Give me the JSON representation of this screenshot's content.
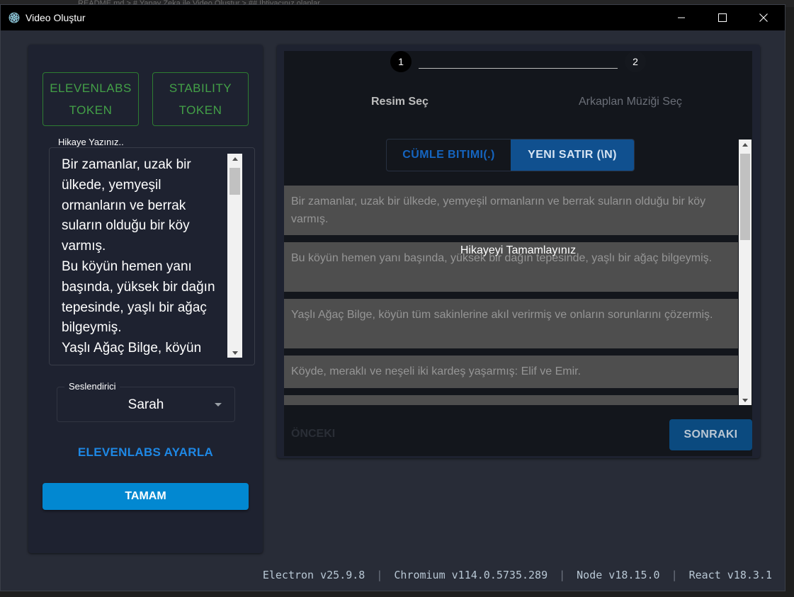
{
  "background_strip": "README.md > # Yapay Zeka ile Video Oluştur > ## İhtiyacınız olanlar",
  "window": {
    "title": "Video Oluştur"
  },
  "left_panel": {
    "elevenlabs_token_label": "ELEVENLABS TOKEN",
    "stability_token_label": "STABILITY TOKEN",
    "story_label": "Hikaye Yazınız..",
    "story_text": "Bir zamanlar, uzak bir ülkede, yemyeşil ormanların ve berrak suların olduğu bir köy varmış.\nBu köyün hemen yanı başında, yüksek bir dağın tepesinde, yaşlı bir ağaç bilgeymiş.\nYaşlı Ağaç Bilge, köyün",
    "voice_label": "Seslendirici",
    "voice_value": "Sarah",
    "elevenlabs_settings_link": "ELEVENLABS AYARLA",
    "ok_button": "TAMAM"
  },
  "stepper": {
    "steps": [
      {
        "number": "1",
        "label": "Resim Seç",
        "active": true
      },
      {
        "number": "2",
        "label": "Arkaplan Müziği Seç",
        "active": false
      }
    ],
    "split_options": [
      "CÜMLE BITIMI(.)",
      "YENI SATIR (\\N)"
    ],
    "selected_split": "YENI SATIR (\\N)",
    "sentences": [
      "Bir zamanlar, uzak bir ülkede, yemyeşil ormanların ve berrak suların olduğu bir köy varmış.",
      "Bu köyün hemen yanı başında, yüksek bir dağın tepesinde, yaşlı bir ağaç bilgeymiş.",
      "Yaşlı Ağaç Bilge, köyün tüm sakinlerine akıl verirmiş ve onların sorunlarını çözermiş.",
      "Köyde, meraklı ve neşeli iki kardeş yaşarmış: Elif ve Emir."
    ],
    "overlay_message": "Hikayeyi Tamamlayınız",
    "prev_button": "ÖNCEKI",
    "next_button": "SONRAKI"
  },
  "footer": {
    "electron": "Electron v25.9.8",
    "chromium": "Chromium v114.0.5735.289",
    "node": "Node v18.15.0",
    "react": "React v18.3.1"
  },
  "colors": {
    "accent_blue": "#0288d1",
    "token_green": "#43a047",
    "link_blue": "#1e88e5",
    "panel_bg": "#1e2230",
    "window_bg": "#282c37"
  }
}
